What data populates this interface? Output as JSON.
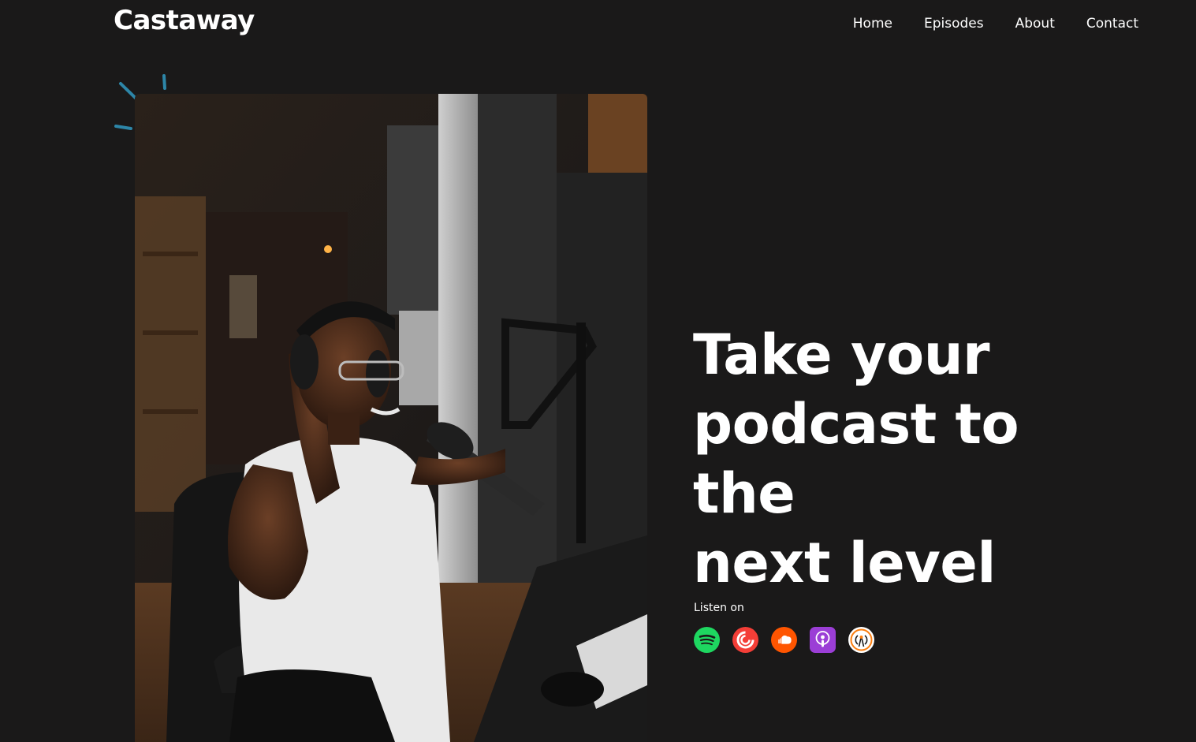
{
  "brand": {
    "name": "Castaway"
  },
  "nav": {
    "items": [
      {
        "label": "Home"
      },
      {
        "label": "Episodes"
      },
      {
        "label": "About"
      },
      {
        "label": "Contact"
      }
    ]
  },
  "hero": {
    "headline_lines": [
      "Take your",
      "podcast to the",
      "next level"
    ],
    "photo_icon": "podcaster-photo",
    "listen_label": "Listen on",
    "platforms": [
      {
        "icon": "spotify-icon",
        "color": "#1ed760"
      },
      {
        "icon": "pocket-casts-icon",
        "color": "#f43e37"
      },
      {
        "icon": "soundcloud-icon",
        "color": "#ff5500"
      },
      {
        "icon": "apple-podcasts-icon",
        "color": "#9b3ed6"
      },
      {
        "icon": "overcast-icon",
        "color": "#fc7e0f"
      }
    ]
  },
  "colors": {
    "background": "#1a1919",
    "accent_sparks": "#2d86a8",
    "text": "#ffffff"
  }
}
